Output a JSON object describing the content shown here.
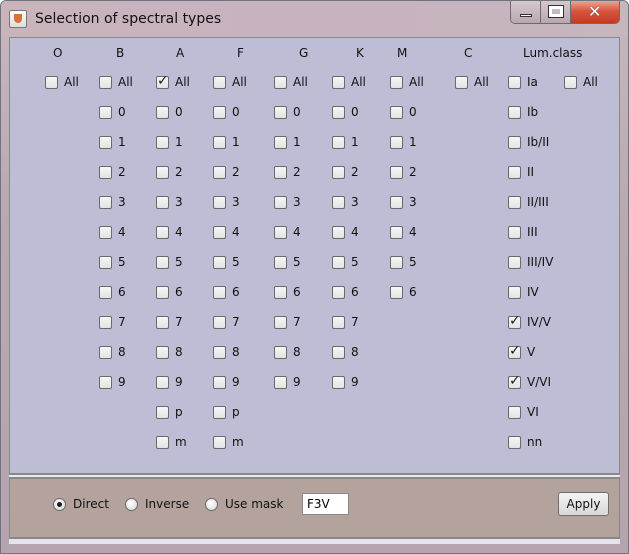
{
  "window": {
    "title": "Selection of spectral types"
  },
  "columns": [
    {
      "key": "O",
      "header": "O",
      "items": [
        {
          "label": "All",
          "checked": false
        }
      ]
    },
    {
      "key": "B",
      "header": "B",
      "items": [
        {
          "label": "All",
          "checked": false
        },
        {
          "label": "0",
          "checked": false
        },
        {
          "label": "1",
          "checked": false
        },
        {
          "label": "2",
          "checked": false
        },
        {
          "label": "3",
          "checked": false
        },
        {
          "label": "4",
          "checked": false
        },
        {
          "label": "5",
          "checked": false
        },
        {
          "label": "6",
          "checked": false
        },
        {
          "label": "7",
          "checked": false
        },
        {
          "label": "8",
          "checked": false
        },
        {
          "label": "9",
          "checked": false
        }
      ]
    },
    {
      "key": "A",
      "header": "A",
      "items": [
        {
          "label": "All",
          "checked": true
        },
        {
          "label": "0",
          "checked": false
        },
        {
          "label": "1",
          "checked": false
        },
        {
          "label": "2",
          "checked": false
        },
        {
          "label": "3",
          "checked": false
        },
        {
          "label": "4",
          "checked": false
        },
        {
          "label": "5",
          "checked": false
        },
        {
          "label": "6",
          "checked": false
        },
        {
          "label": "7",
          "checked": false
        },
        {
          "label": "8",
          "checked": false
        },
        {
          "label": "9",
          "checked": false
        },
        {
          "label": "p",
          "checked": false
        },
        {
          "label": "m",
          "checked": false
        }
      ]
    },
    {
      "key": "F",
      "header": "F",
      "items": [
        {
          "label": "All",
          "checked": false
        },
        {
          "label": "0",
          "checked": false
        },
        {
          "label": "1",
          "checked": false
        },
        {
          "label": "2",
          "checked": false
        },
        {
          "label": "3",
          "checked": false
        },
        {
          "label": "4",
          "checked": false
        },
        {
          "label": "5",
          "checked": false
        },
        {
          "label": "6",
          "checked": false
        },
        {
          "label": "7",
          "checked": false
        },
        {
          "label": "8",
          "checked": false
        },
        {
          "label": "9",
          "checked": false
        },
        {
          "label": "p",
          "checked": false
        },
        {
          "label": "m",
          "checked": false
        }
      ]
    },
    {
      "key": "G",
      "header": "G",
      "items": [
        {
          "label": "All",
          "checked": false
        },
        {
          "label": "0",
          "checked": false
        },
        {
          "label": "1",
          "checked": false
        },
        {
          "label": "2",
          "checked": false
        },
        {
          "label": "3",
          "checked": false
        },
        {
          "label": "4",
          "checked": false
        },
        {
          "label": "5",
          "checked": false
        },
        {
          "label": "6",
          "checked": false
        },
        {
          "label": "7",
          "checked": false
        },
        {
          "label": "8",
          "checked": false
        },
        {
          "label": "9",
          "checked": false
        }
      ]
    },
    {
      "key": "K",
      "header": "K",
      "items": [
        {
          "label": "All",
          "checked": false
        },
        {
          "label": "0",
          "checked": false
        },
        {
          "label": "1",
          "checked": false
        },
        {
          "label": "2",
          "checked": false
        },
        {
          "label": "3",
          "checked": false
        },
        {
          "label": "4",
          "checked": false
        },
        {
          "label": "5",
          "checked": false
        },
        {
          "label": "6",
          "checked": false
        },
        {
          "label": "7",
          "checked": false
        },
        {
          "label": "8",
          "checked": false
        },
        {
          "label": "9",
          "checked": false
        }
      ]
    },
    {
      "key": "M",
      "header": "M",
      "items": [
        {
          "label": "All",
          "checked": false
        },
        {
          "label": "0",
          "checked": false
        },
        {
          "label": "1",
          "checked": false
        },
        {
          "label": "2",
          "checked": false
        },
        {
          "label": "3",
          "checked": false
        },
        {
          "label": "4",
          "checked": false
        },
        {
          "label": "5",
          "checked": false
        },
        {
          "label": "6",
          "checked": false
        }
      ]
    },
    {
      "key": "C",
      "header": "C",
      "items": [
        {
          "label": "All",
          "checked": false
        }
      ]
    },
    {
      "key": "Lum",
      "header": "Lum.class",
      "items": [
        {
          "label": "Ia",
          "checked": false
        },
        {
          "label": "Ib",
          "checked": false
        },
        {
          "label": "Ib/II",
          "checked": false
        },
        {
          "label": "II",
          "checked": false
        },
        {
          "label": "II/III",
          "checked": false
        },
        {
          "label": "III",
          "checked": false
        },
        {
          "label": "III/IV",
          "checked": false
        },
        {
          "label": "IV",
          "checked": false
        },
        {
          "label": "IV/V",
          "checked": true
        },
        {
          "label": "V",
          "checked": true
        },
        {
          "label": "V/VI",
          "checked": true
        },
        {
          "label": "VI",
          "checked": false
        },
        {
          "label": "nn",
          "checked": false
        }
      ]
    }
  ],
  "lum_all": {
    "label": "All",
    "checked": false
  },
  "mode": {
    "options": [
      {
        "label": "Direct",
        "selected": true
      },
      {
        "label": "Inverse",
        "selected": false
      },
      {
        "label": "Use mask",
        "selected": false
      }
    ],
    "mask_value": "F3V"
  },
  "apply_label": "Apply"
}
